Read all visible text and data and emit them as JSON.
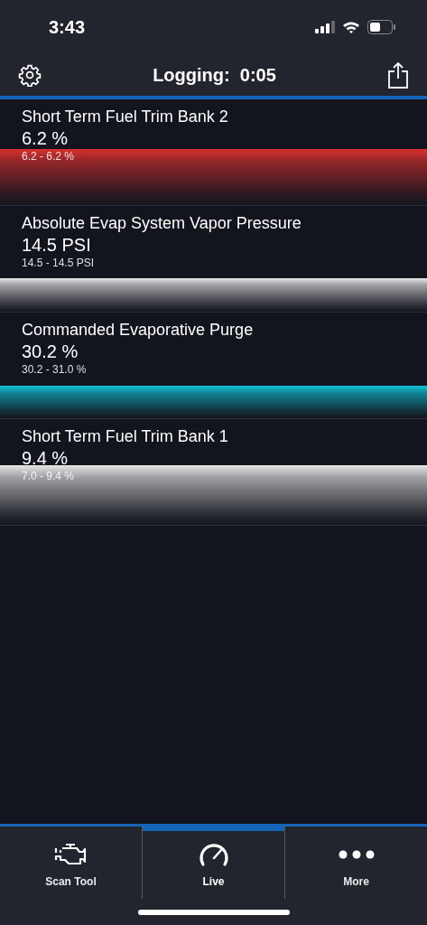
{
  "status_bar": {
    "time": "3:43"
  },
  "header": {
    "title": "Logging:  0:05"
  },
  "gauges": [
    {
      "name": "Short Term Fuel Trim Bank 2",
      "value": "6.2 %",
      "range": "6.2 - 6.2 %",
      "color": "#d9302f"
    },
    {
      "name": "Absolute Evap System Vapor Pressure",
      "value": "14.5 PSI",
      "range": "14.5 - 14.5 PSI",
      "color": "#e6e6e6"
    },
    {
      "name": "Commanded Evaporative Purge",
      "value": "30.2 %",
      "range": "30.2 - 31.0 %",
      "color": "#10c4d8"
    },
    {
      "name": "Short Term Fuel Trim Bank 1",
      "value": "9.4 %",
      "range": "7.0 - 9.4 %",
      "color": "#e6e6e6"
    }
  ],
  "tabs": [
    {
      "kind": "engine",
      "label": "Scan Tool",
      "selected": false
    },
    {
      "kind": "gauge",
      "label": "Live",
      "selected": true
    },
    {
      "kind": "more",
      "label": "More",
      "selected": false
    }
  ]
}
